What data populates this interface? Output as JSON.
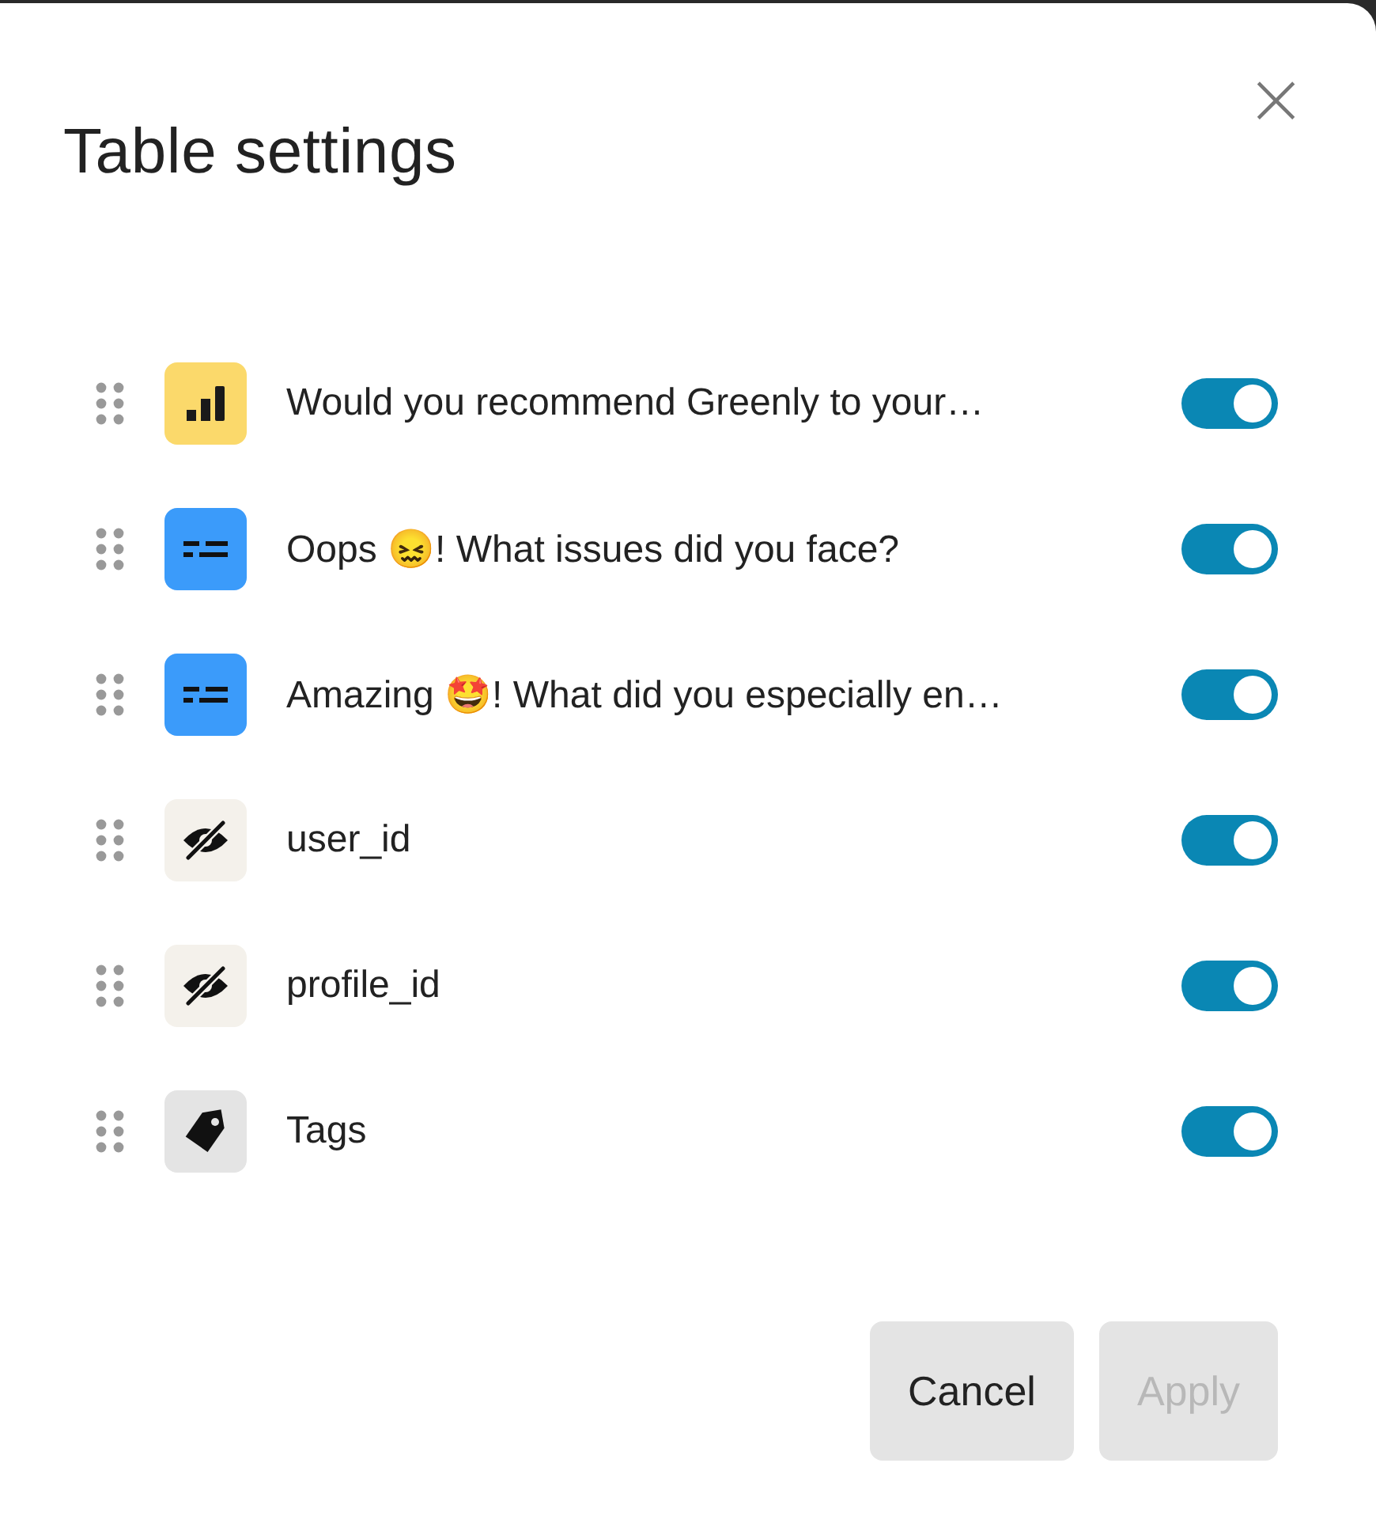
{
  "dialog": {
    "title": "Table settings",
    "close": "×"
  },
  "columns": [
    {
      "kind": "rating",
      "label": "Would you recommend Greenly to your…",
      "on": true
    },
    {
      "kind": "text",
      "label": "Oops 😖! What issues did you face?",
      "on": true
    },
    {
      "kind": "text",
      "label": "Amazing 🤩! What did you especially en…",
      "on": true
    },
    {
      "kind": "hidden",
      "label": "user_id",
      "on": true
    },
    {
      "kind": "hidden",
      "label": "profile_id",
      "on": true
    },
    {
      "kind": "tag",
      "label": "Tags",
      "on": true
    }
  ],
  "buttons": [
    {
      "label": "Cancel",
      "disabled": false
    },
    {
      "label": "Apply",
      "disabled": true
    }
  ]
}
